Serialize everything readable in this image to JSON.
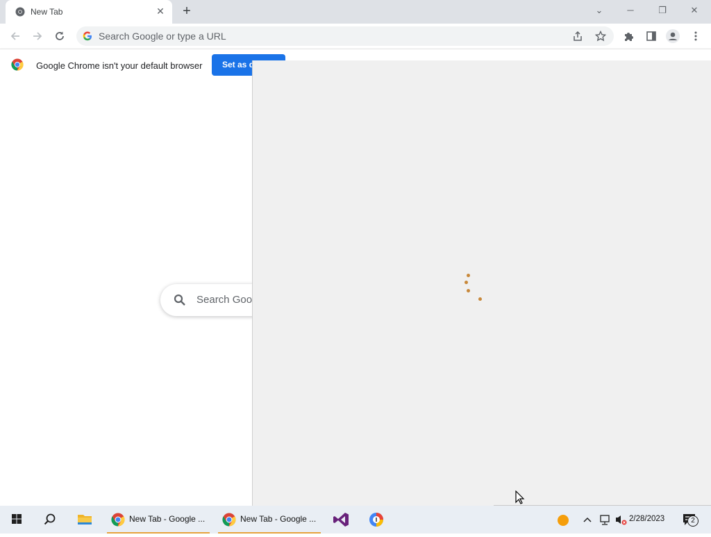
{
  "browser": {
    "tab": {
      "title": "New Tab"
    },
    "omnibox": {
      "placeholder": "Search Google or type a URL"
    },
    "infobar": {
      "message": "Google Chrome isn't your default browser",
      "button_label": "Set as default"
    },
    "ntp": {
      "search_placeholder": "Search Google or type a URL"
    }
  },
  "taskbar": {
    "apps": [
      {
        "label": "New Tab - Google ..."
      },
      {
        "label": "New Tab - Google ..."
      }
    ],
    "clock": {
      "date": "2/28/2023"
    },
    "notification_count": "2"
  },
  "colors": {
    "accent_blue": "#1a73e8",
    "overlay_bg": "#f0f0f0",
    "spinner": "#c8883a",
    "taskbar_highlight": "#e6a23c"
  }
}
